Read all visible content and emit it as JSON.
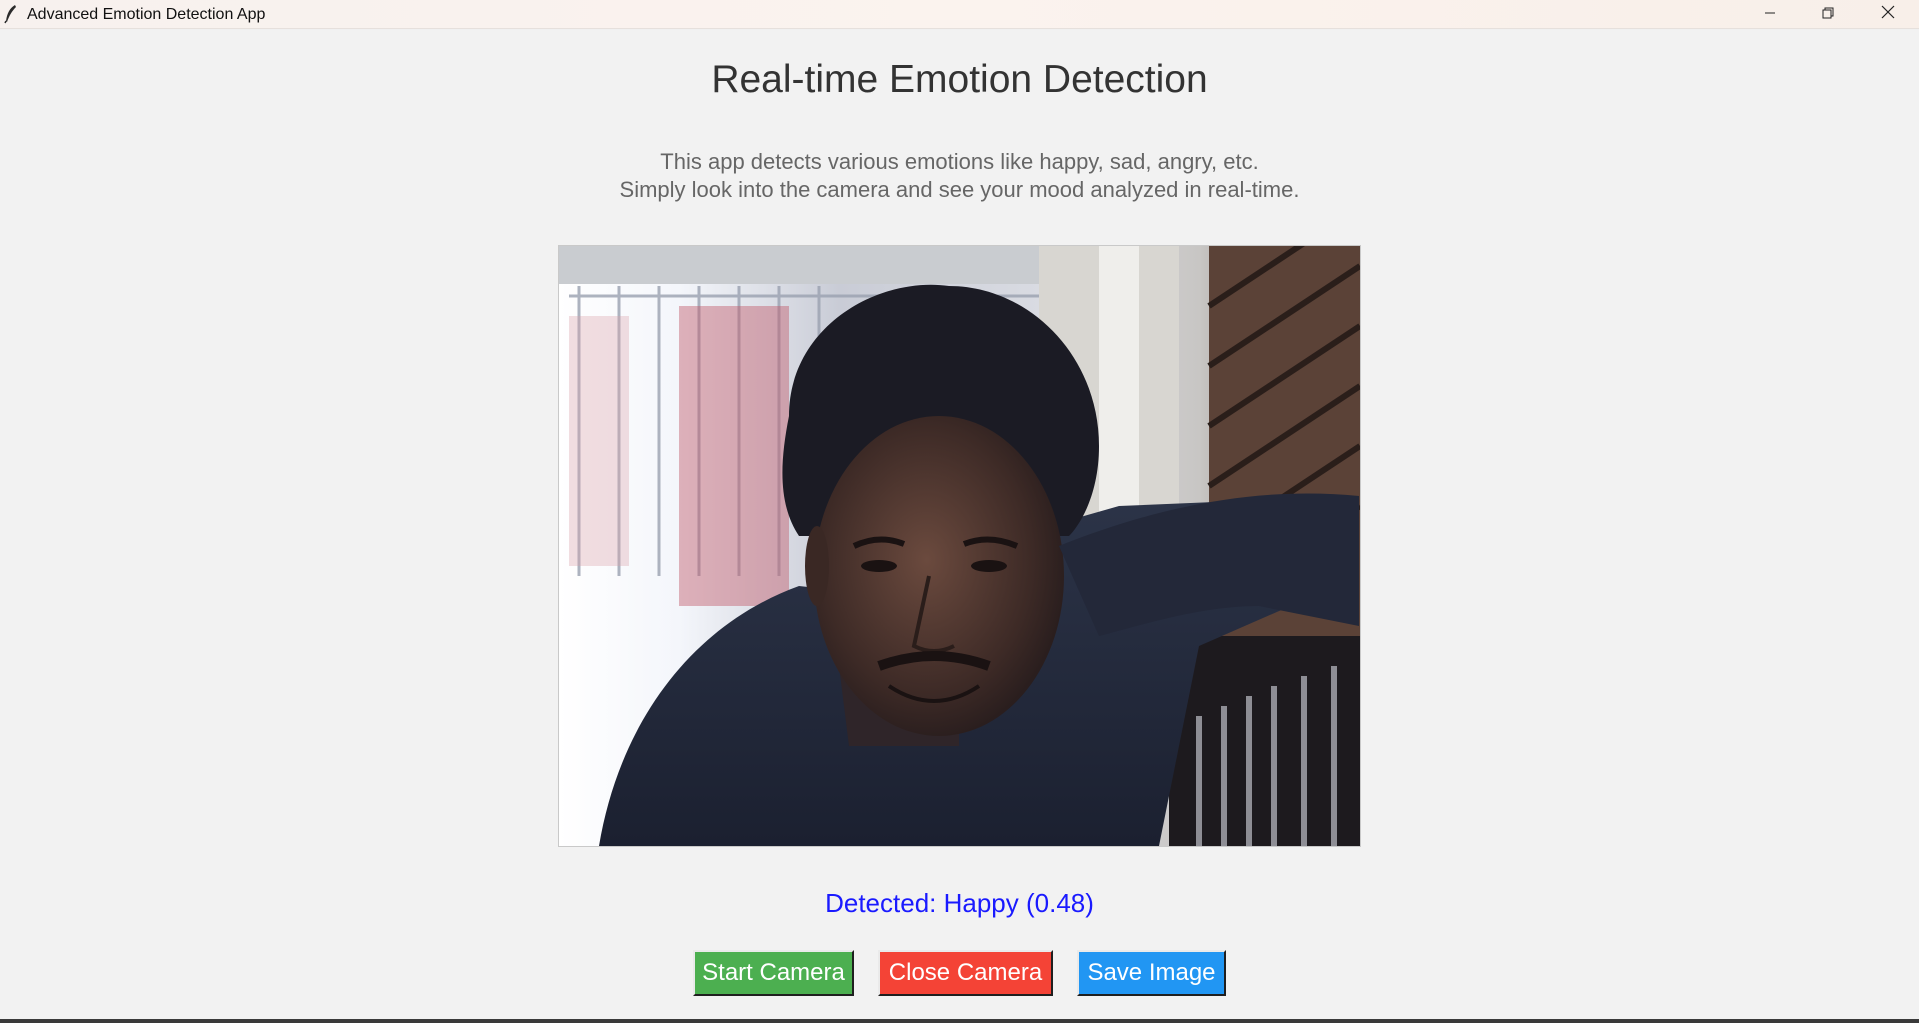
{
  "window": {
    "title": "Advanced Emotion Detection App",
    "icon": "feather-icon",
    "controls": {
      "minimize_icon": "minimize-icon",
      "maximize_icon": "restore-icon",
      "close_icon": "close-icon"
    }
  },
  "main": {
    "heading": "Real-time Emotion Detection",
    "description_line1": "This app detects various emotions like happy, sad, angry, etc.",
    "description_line2": "Simply look into the camera and see your mood analyzed in real-time.",
    "status": "Detected: Happy (0.48)"
  },
  "buttons": {
    "start": "Start Camera",
    "close": "Close Camera",
    "save": "Save Image"
  },
  "colors": {
    "start": "#4caf50",
    "close": "#f44336",
    "save": "#2196f3",
    "status_text": "#1a1aff",
    "heading_text": "#333333"
  }
}
